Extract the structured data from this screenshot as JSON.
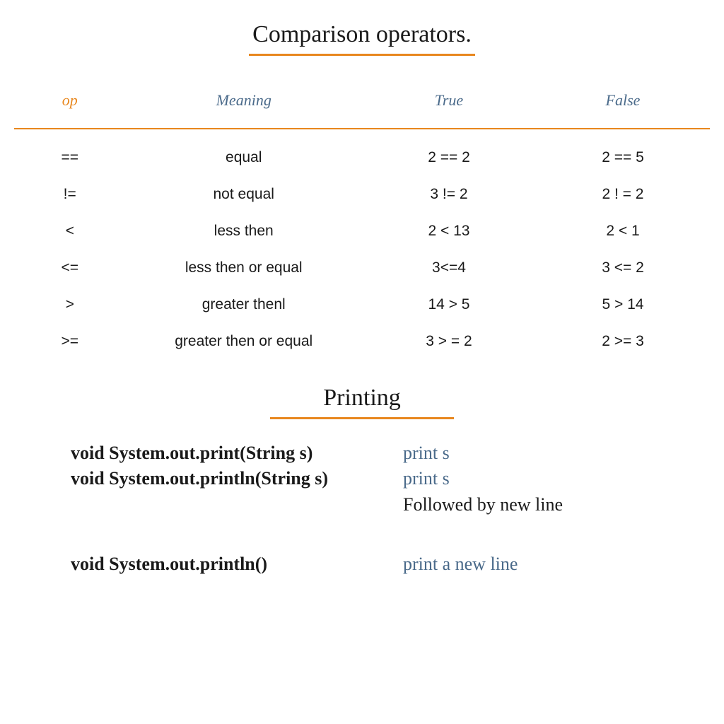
{
  "sections": {
    "comparison": {
      "title": "Comparison operators.",
      "headers": {
        "op": "op",
        "meaning": "Meaning",
        "true": "True",
        "false": "False"
      },
      "rows": [
        {
          "op": "==",
          "meaning": "equal",
          "true": "2 == 2",
          "false": "2 == 5"
        },
        {
          "op": "!=",
          "meaning": "not equal",
          "true": "3 != 2",
          "false": "2 ! = 2"
        },
        {
          "op": "<",
          "meaning": "less then",
          "true": "2 < 13",
          "false": "2 < 1"
        },
        {
          "op": "<=",
          "meaning": "less then or equal",
          "true": "3<=4",
          "false": "3  <= 2"
        },
        {
          "op": ">",
          "meaning": "greater thenl",
          "true": "14 > 5",
          "false": "5 > 14"
        },
        {
          "op": ">=",
          "meaning": "greater then or equal",
          "true": "3 > = 2",
          "false": "2 >= 3"
        }
      ]
    },
    "printing": {
      "title": "Printing",
      "items": [
        {
          "sig": "void System.out.print(String s)",
          "desc": "print s",
          "extra": ""
        },
        {
          "sig": "void System.out.println(String s)",
          "desc": "print s",
          "extra": "Followed by new line"
        },
        {
          "sig": "void System.out.println()",
          "desc": "print a new line",
          "extra": ""
        }
      ]
    }
  }
}
